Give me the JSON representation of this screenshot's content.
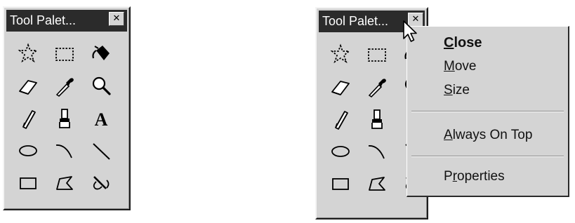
{
  "palettes": [
    {
      "title": "Tool Palet...",
      "close_glyph": "✕"
    },
    {
      "title": "Tool Palet...",
      "close_glyph": "✕"
    }
  ],
  "tools": [
    {
      "name": "lasso-icon"
    },
    {
      "name": "marquee-icon"
    },
    {
      "name": "paint-bucket-icon"
    },
    {
      "name": "eraser-icon"
    },
    {
      "name": "eyedropper-icon"
    },
    {
      "name": "magnifier-icon"
    },
    {
      "name": "pencil-icon"
    },
    {
      "name": "brush-icon"
    },
    {
      "name": "text-icon",
      "glyph": "A"
    },
    {
      "name": "ellipse-icon"
    },
    {
      "name": "arc-icon"
    },
    {
      "name": "line-icon"
    },
    {
      "name": "rectangle-icon"
    },
    {
      "name": "polygon-icon"
    },
    {
      "name": "reshape-icon"
    }
  ],
  "context_menu": {
    "items": [
      {
        "label": "Close",
        "mnemonic": "C",
        "default": true
      },
      {
        "label": "Move",
        "mnemonic": "M"
      },
      {
        "label": "Size",
        "mnemonic": "S"
      },
      {
        "label": "Always On Top",
        "mnemonic": "A"
      },
      {
        "label": "Properties",
        "mnemonic": "r"
      }
    ]
  },
  "colors": {
    "face": "#d4d4d4",
    "titlebar": "#2b2b2b",
    "titlebar_text": "#ffffff"
  }
}
